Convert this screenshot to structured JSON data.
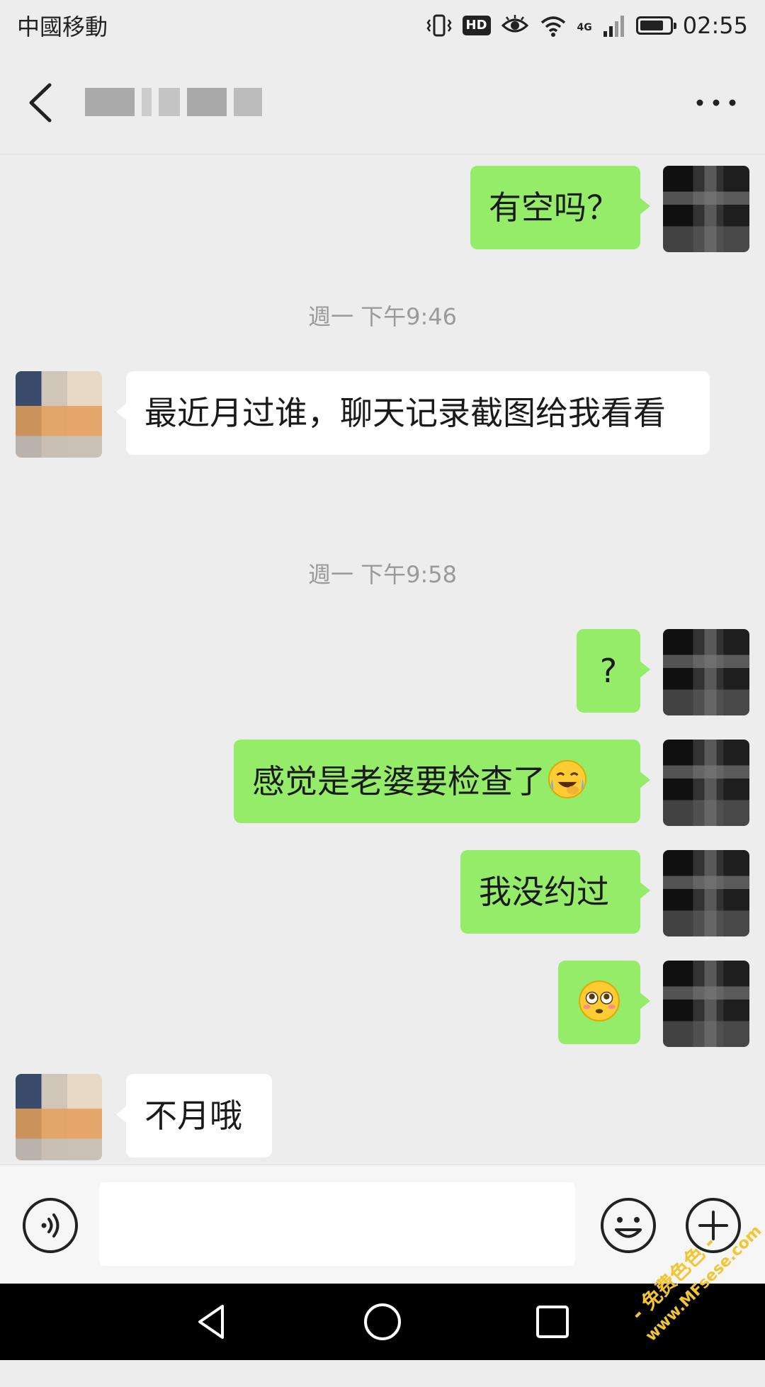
{
  "status_bar": {
    "carrier": "中國移動",
    "hd_label": "HD",
    "network_label": "4G",
    "time": "02:55",
    "battery_level": 0.8
  },
  "header": {
    "back_icon": "chevron-left-icon",
    "more_icon": "more-dots-icon"
  },
  "messages": [
    {
      "id": 1,
      "sender": "me",
      "text": "有空吗？"
    },
    {
      "id": 2,
      "type": "timestamp",
      "text": "週一 下午9:46"
    },
    {
      "id": 3,
      "sender": "other",
      "text": "最近月过谁，聊天记录截图给我看看"
    },
    {
      "id": 4,
      "type": "timestamp",
      "text": "週一 下午9:58"
    },
    {
      "id": 5,
      "sender": "me",
      "text": "?"
    },
    {
      "id": 6,
      "sender": "me",
      "text": "感觉是老婆要检查了",
      "emoji": "crying-laughing-emoji"
    },
    {
      "id": 7,
      "sender": "me",
      "text": "我没约过"
    },
    {
      "id": 8,
      "sender": "me",
      "emoji": "flushed-face-emoji"
    },
    {
      "id": 9,
      "sender": "other",
      "text": "不月哦"
    }
  ],
  "input_bar": {
    "voice_icon": "voice-icon",
    "emoji_icon": "emoji-icon",
    "plus_icon": "plus-icon",
    "placeholder": ""
  },
  "system_nav": {
    "back_icon": "triangle-back-icon",
    "home_icon": "circle-home-icon",
    "recents_icon": "square-recents-icon"
  },
  "watermark": {
    "line1": "- 免费色色 -",
    "line2": "www.MFsese.com"
  },
  "colors": {
    "background": "#ededed",
    "my_bubble": "#95ec69",
    "their_bubble": "#ffffff",
    "timestamp_text": "#9a9a9a",
    "watermark": "#f3c531"
  }
}
